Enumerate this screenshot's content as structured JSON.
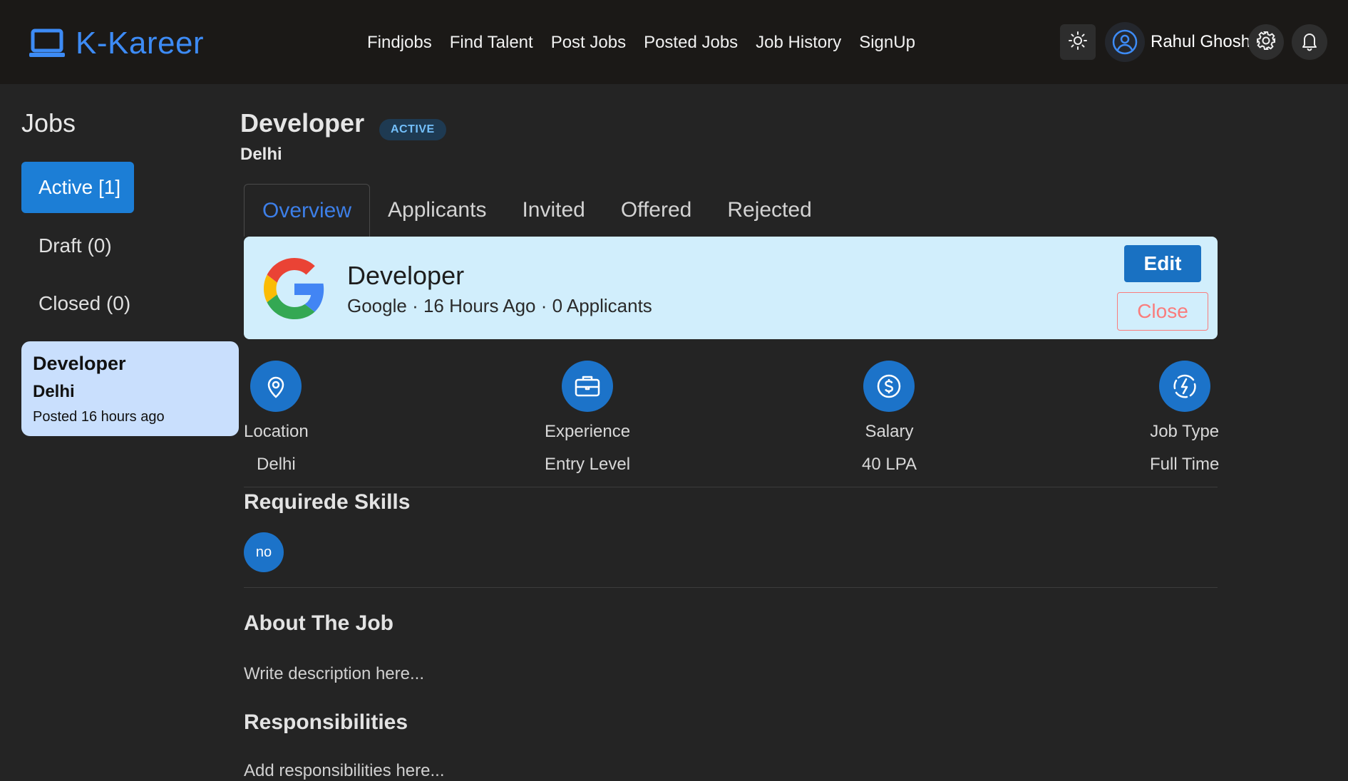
{
  "header": {
    "brand": "K-Kareer",
    "nav": [
      "Findjobs",
      "Find Talent",
      "Post Jobs",
      "Posted Jobs",
      "Job History",
      "SignUp"
    ],
    "user_name": "Rahul Ghosh",
    "icons": {
      "logo": "laptop-icon",
      "theme": "sun-icon",
      "avatar": "user-circle-icon",
      "settings": "gear-icon",
      "notifications": "bell-icon"
    }
  },
  "sidebar": {
    "title": "Jobs",
    "tabs": [
      {
        "label": "Active [1]",
        "active": true
      },
      {
        "label": "Draft (0)",
        "active": false
      },
      {
        "label": "Closed (0)",
        "active": false
      }
    ],
    "job_card": {
      "title": "Developer",
      "location": "Delhi",
      "posted": "Posted 16 hours ago"
    }
  },
  "main": {
    "title": "Developer",
    "status_badge": "ACTIVE",
    "location": "Delhi",
    "tabs": [
      "Overview",
      "Applicants",
      "Invited",
      "Offered",
      "Rejected"
    ],
    "active_tab": "Overview",
    "banner": {
      "title": "Developer",
      "subtitle": "Google · 16 Hours Ago · 0 Applicants",
      "edit_label": "Edit",
      "close_label": "Close"
    },
    "stats": [
      {
        "label": "Location",
        "value": "Delhi",
        "icon": "map-pin-icon"
      },
      {
        "label": "Experience",
        "value": "Entry Level",
        "icon": "briefcase-icon"
      },
      {
        "label": "Salary",
        "value": "40 LPA",
        "icon": "dollar-icon"
      },
      {
        "label": "Job Type",
        "value": "Full Time",
        "icon": "bolt-icon"
      }
    ],
    "skills_title": "Requirede Skills",
    "skills": [
      "no"
    ],
    "about_title": "About The Job",
    "about_text": "Write description here...",
    "responsibilities_title": "Responsibilities",
    "responsibilities_text": "Add responsibilities here..."
  },
  "colors": {
    "accent": "#1c7ed6",
    "brand": "#3d8bf5",
    "banner_bg": "#d1eefc",
    "danger": "#fa7c7c"
  }
}
